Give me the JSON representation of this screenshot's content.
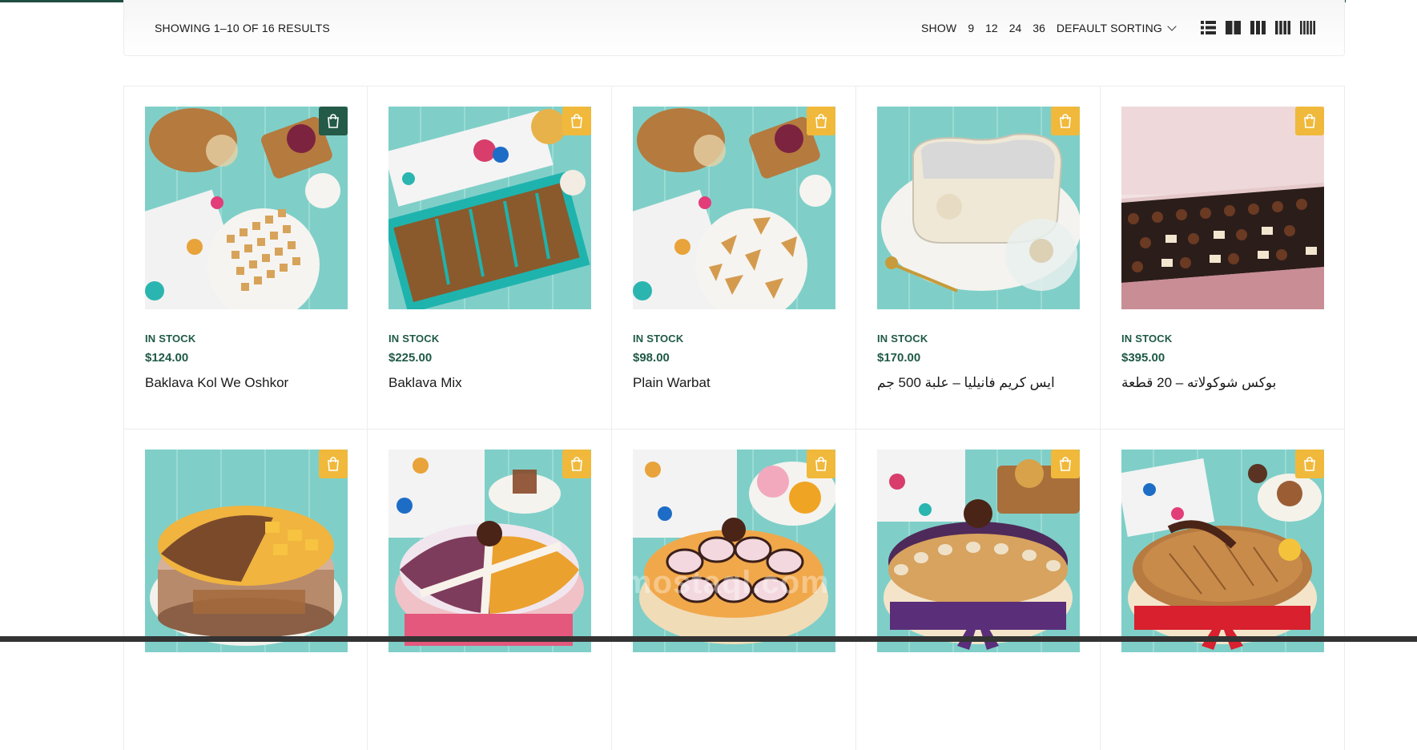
{
  "toolbar": {
    "results_text": "SHOWING 1–10 OF 16 RESULTS",
    "show_label": "SHOW",
    "show_options": [
      "9",
      "12",
      "24",
      "36"
    ],
    "sorting_label": "DEFAULT SORTING",
    "view_icons": [
      "list-view-icon",
      "grid-2-icon",
      "grid-3-icon",
      "grid-4-icon",
      "grid-5-icon"
    ]
  },
  "colors": {
    "accent_green": "#1f5a45",
    "bag_yellow": "#f0b93b",
    "bag_active": "#245a48",
    "table_teal": "#7fcfc8"
  },
  "products": [
    {
      "stock": "IN STOCK",
      "price": "$124.00",
      "name": "Baklava Kol We Oshkor",
      "image": "baklava-platter-photo"
    },
    {
      "stock": "IN STOCK",
      "price": "$225.00",
      "name": "Baklava Mix",
      "image": "baklava-box-photo"
    },
    {
      "stock": "IN STOCK",
      "price": "$98.00",
      "name": "Plain Warbat",
      "image": "warbat-platter-photo"
    },
    {
      "stock": "IN STOCK",
      "price": "$170.00",
      "name": "ايس كريم فانيليا – علبة 500 جم",
      "image": "ice-cream-tub-photo"
    },
    {
      "stock": "IN STOCK",
      "price": "$395.00",
      "name": "بوكس شوكولاته – 20 قطعة",
      "image": "chocolate-box-photo"
    },
    {
      "image": "mango-cake-photo"
    },
    {
      "image": "mixed-cheesecake-photo"
    },
    {
      "image": "striped-mousse-cake-photo"
    },
    {
      "image": "berry-crumble-cake-photo"
    },
    {
      "image": "caramel-cake-photo"
    }
  ],
  "watermark": "mostaql.com"
}
